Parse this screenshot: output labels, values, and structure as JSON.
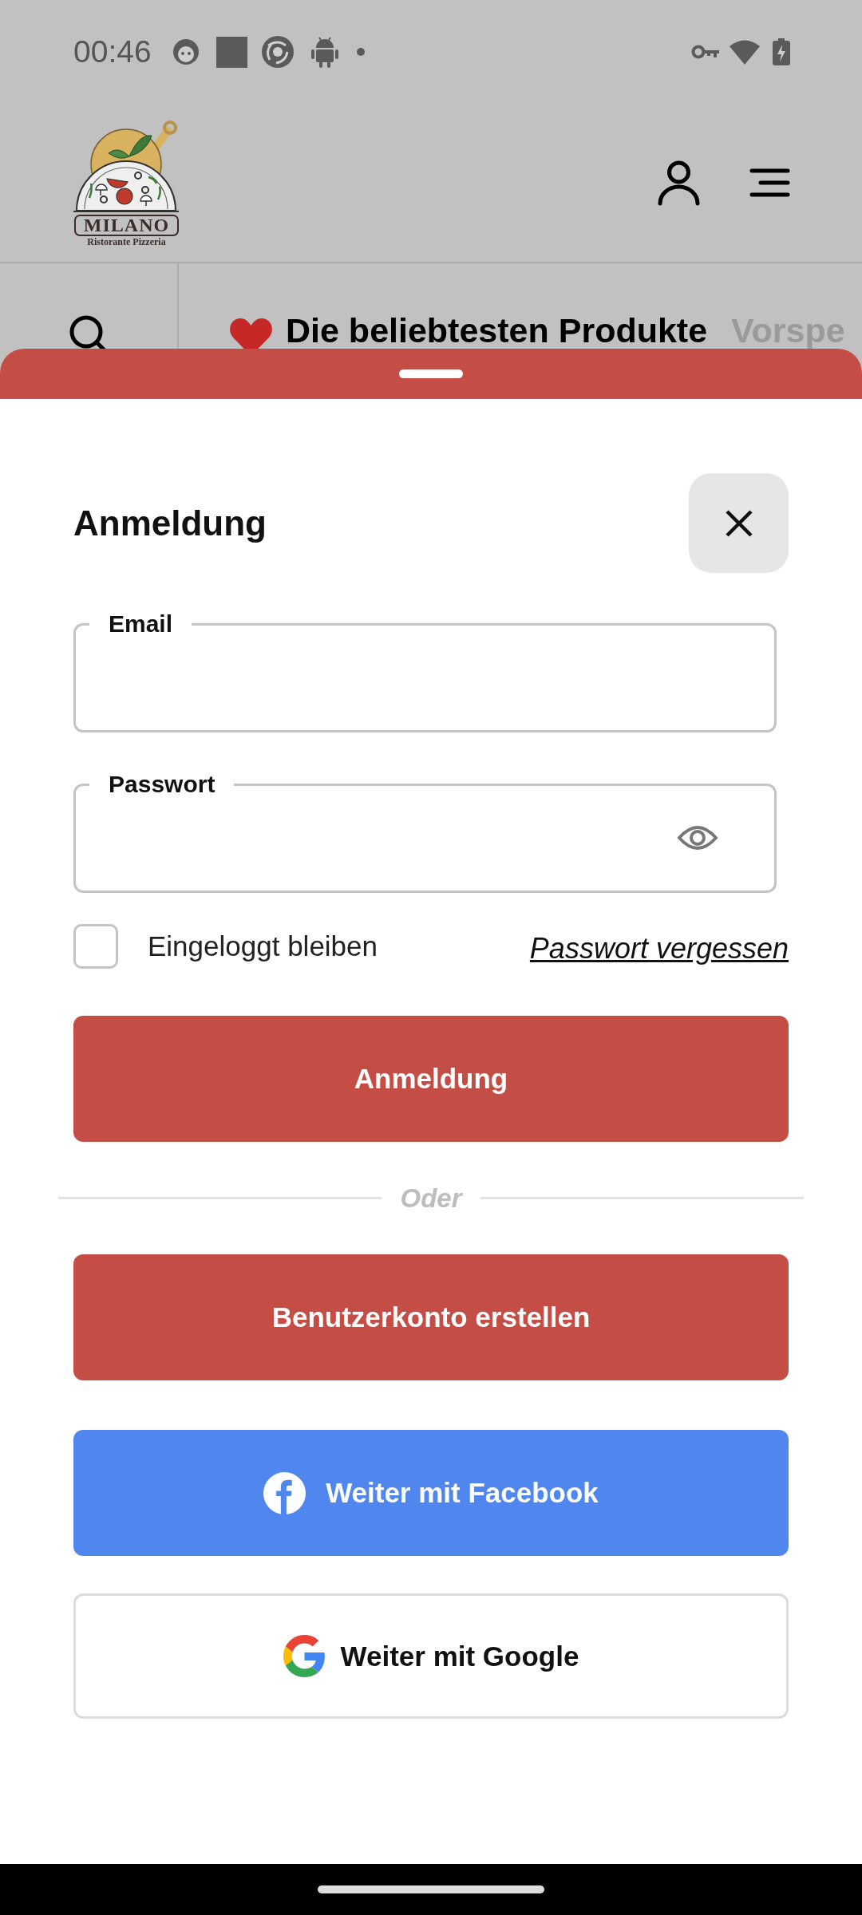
{
  "status_bar": {
    "time": "00:46"
  },
  "header": {
    "logo": {
      "name": "MILANO",
      "tagline": "Ristorante Pizzeria"
    }
  },
  "category_tabs": [
    {
      "label": "Die beliebtesten Produkte",
      "kind": "favorites",
      "selected": true
    },
    {
      "label": "Vorspe",
      "kind": "category",
      "selected": false
    }
  ],
  "login_sheet": {
    "title": "Anmeldung",
    "fields": [
      {
        "label": "Email",
        "kind": "text"
      },
      {
        "label": "Passwort",
        "kind": "password"
      }
    ],
    "remember_me": {
      "label": "Eingeloggt bleiben",
      "checked": false
    },
    "forgot_password": "Passwort vergessen",
    "submit_button": "Anmeldung",
    "divider": "Oder",
    "alt_buttons": [
      {
        "label": "Benutzerkonto erstellen",
        "kind": "primary"
      },
      {
        "label": "Weiter mit Facebook",
        "kind": "facebook"
      },
      {
        "label": "Weiter mit Google",
        "kind": "google"
      }
    ]
  }
}
